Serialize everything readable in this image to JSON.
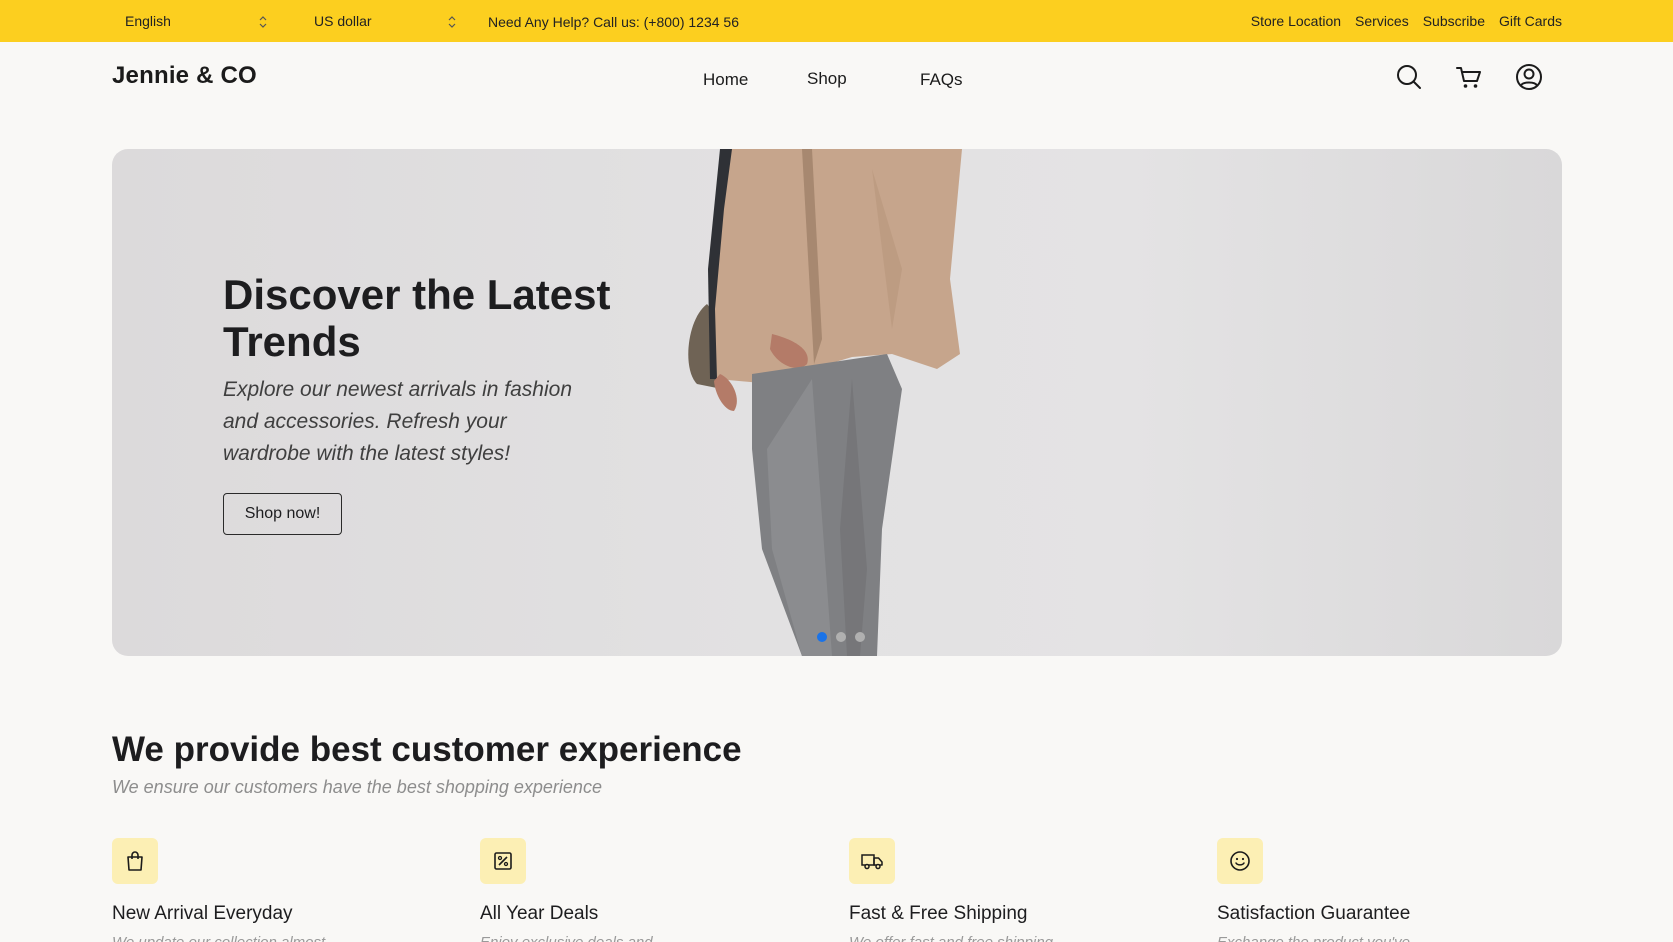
{
  "topbar": {
    "language": "English",
    "currency": "US dollar",
    "help_text": "Need Any Help? Call us: (+800) 1234 56",
    "links": [
      "Store Location",
      "Services",
      "Subscribe",
      "Gift Cards"
    ]
  },
  "header": {
    "logo": "Jennie & CO",
    "nav": [
      "Home",
      "Shop",
      "FAQs"
    ],
    "icons": [
      "search-icon",
      "cart-icon",
      "user-icon"
    ]
  },
  "hero": {
    "title": "Discover the Latest Trends",
    "subtitle": "Explore our newest arrivals in fashion and accessories. Refresh your wardrobe with the latest styles!",
    "button": "Shop now!",
    "slides_count": 3,
    "active_slide": 1
  },
  "section": {
    "title": "We provide best customer experience",
    "subtitle": "We ensure our customers have the best shopping experience",
    "features": [
      {
        "icon": "shopping-bag-icon",
        "title": "New Arrival Everyday",
        "desc": "We update our collection almost"
      },
      {
        "icon": "percent-tag-icon",
        "title": "All Year Deals",
        "desc": "Enjoy exclusive deals and"
      },
      {
        "icon": "delivery-truck-icon",
        "title": "Fast & Free Shipping",
        "desc": "We offer fast and free shipping"
      },
      {
        "icon": "smiley-icon",
        "title": "Satisfaction Guarantee",
        "desc": "Exchange the product you've"
      }
    ]
  },
  "colors": {
    "topbar_bg": "#fccf1f",
    "page_bg": "#f9f8f6",
    "feature_icon_bg": "#fcefb4",
    "active_dot": "#1a73e8"
  }
}
